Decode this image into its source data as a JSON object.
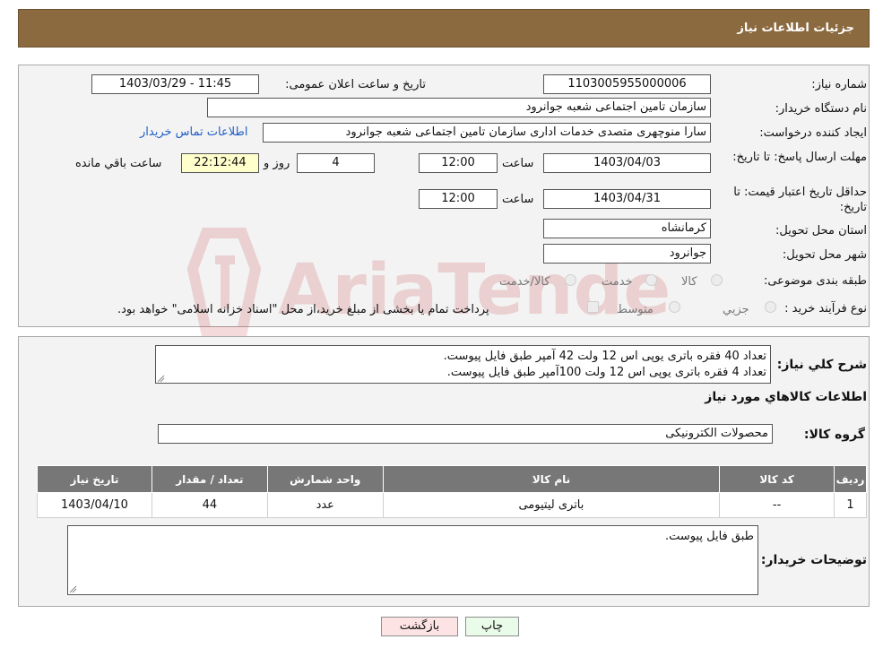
{
  "header": {
    "title": "جزئیات اطلاعات نیاز"
  },
  "form": {
    "need_number_label": "شماره نیاز:",
    "need_number": "1103005955000006",
    "announce_label": "تاریخ و ساعت اعلان عمومی:",
    "announce_value": "1403/03/29 - 11:45",
    "buyer_org_label": "نام دستگاه خریدار:",
    "buyer_org": "سازمان تامین اجتماعی شعبه جوانرود",
    "creator_label": "ایجاد کننده درخواست:",
    "creator": "سارا منوچهری متصدی خدمات اداری  سازمان تامین اجتماعی شعبه جوانرود",
    "contact_link": "اطلاعات تماس خریدار",
    "deadline_label": "مهلت ارسال پاسخ: تا تاریخ:",
    "deadline_date": "1403/04/03",
    "time_label": "ساعت",
    "deadline_time": "12:00",
    "days": "4",
    "days_label": "روز و",
    "remaining": "22:12:44",
    "remaining_label": "ساعت باقي مانده",
    "validity_label": "حداقل تاریخ اعتبار قیمت: تا تاریخ:",
    "validity_date": "1403/04/31",
    "validity_time": "12:00",
    "province_label": "استان محل تحویل:",
    "province": "کرمانشاه",
    "city_label": "شهر محل تحویل:",
    "city": "جوانرود",
    "category_label": "طبقه بندی موضوعی:",
    "category_options": [
      "کالا",
      "خدمت",
      "کالا/خدمت"
    ],
    "process_label": "نوع فرآیند خرید :",
    "process_options": [
      "جزيي",
      "متوسط"
    ],
    "process_note": "پرداخت تمام یا بخشی از مبلغ خرید،از محل \"اسناد خزانه اسلامی\" خواهد بود."
  },
  "description": {
    "label": "شرح کلي نياز:",
    "line1": "تعداد 40 فقره باتری یوپی اس 12 ولت 42 آمپر طبق فایل پیوست.",
    "line2": "تعداد 4 فقره باتری یوپی اس 12 ولت 100آمپر طبق فایل پیوست."
  },
  "goods": {
    "section_title": "اطلاعات کالاهاي مورد نياز",
    "group_label": "گروه کالا:",
    "group_value": "محصولات الکترونیکی",
    "columns": [
      "رديف",
      "کد کالا",
      "نام کالا",
      "واحد شمارش",
      "تعداد / مقدار",
      "تاريخ نياز"
    ],
    "rows": [
      {
        "index": "1",
        "code": "--",
        "name": "باتری لیتیومی",
        "unit": "عدد",
        "qty": "44",
        "date": "1403/04/10"
      }
    ]
  },
  "buyer_notes": {
    "label": "توضیحات خریدار:",
    "text": "طبق فایل پیوست."
  },
  "buttons": {
    "print": "چاپ",
    "back": "بازگشت"
  },
  "watermark": {
    "text": "AriaTender.neT"
  },
  "colors": {
    "header": "#8c6a3f",
    "link": "#1f5ec8",
    "table_header": "#777777",
    "remaining_bg": "#ffffcc",
    "print_btn": "#e9fbe9",
    "back_btn": "#fde3e3"
  }
}
